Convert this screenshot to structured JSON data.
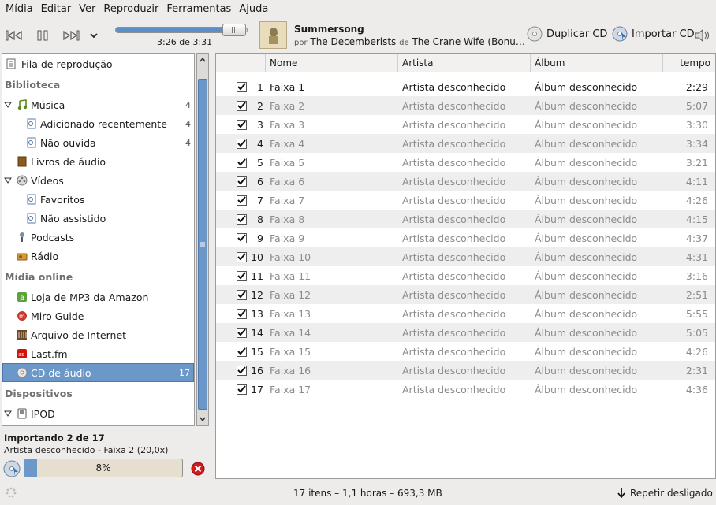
{
  "menu": [
    "Mídia",
    "Editar",
    "Ver",
    "Reproduzir",
    "Ferramentas",
    "Ajuda"
  ],
  "player": {
    "time": "3:26 de 3:31",
    "progress": 0.976,
    "title": "Summersong",
    "by_label": "por",
    "artist": "The Decemberists",
    "of_label": "de",
    "album": "The Crane Wife (Bonu…"
  },
  "actions": {
    "duplicate_cd": "Duplicar CD",
    "import_cd": "Importar CD"
  },
  "sidebar": {
    "queue": "Fila de reprodução",
    "library_header": "Biblioteca",
    "music": "Música",
    "music_count": "4",
    "recent": "Adicionado recentemente",
    "recent_count": "4",
    "unheard": "Não ouvida",
    "unheard_count": "4",
    "audiobooks": "Livros de áudio",
    "videos": "Vídeos",
    "favorites": "Favoritos",
    "unwatched": "Não assistido",
    "podcasts": "Podcasts",
    "radio": "Rádio",
    "online_header": "Mídia online",
    "amazon": "Loja de MP3 da Amazon",
    "miro": "Miro Guide",
    "archive": "Arquivo de Internet",
    "lastfm": "Last.fm",
    "audio_cd": "CD de áudio",
    "audio_cd_count": "17",
    "devices_header": "Dispositivos",
    "ipod": "IPOD"
  },
  "import": {
    "title": "Importando 2 de 17",
    "detail": "Artista desconhecido - Faixa 2 (20,0x)",
    "percent_label": "8%",
    "percent": 0.08
  },
  "table": {
    "headers": {
      "name": "Nome",
      "artist": "Artista",
      "album": "Álbum",
      "time": "tempo"
    },
    "rows": [
      {
        "n": "1",
        "name": "Faixa 1",
        "artist": "Artista desconhecido",
        "album": "Álbum desconhecido",
        "time": "2:29"
      },
      {
        "n": "2",
        "name": "Faixa 2",
        "artist": "Artista desconhecido",
        "album": "Álbum desconhecido",
        "time": "5:07"
      },
      {
        "n": "3",
        "name": "Faixa 3",
        "artist": "Artista desconhecido",
        "album": "Álbum desconhecido",
        "time": "3:30"
      },
      {
        "n": "4",
        "name": "Faixa 4",
        "artist": "Artista desconhecido",
        "album": "Álbum desconhecido",
        "time": "3:34"
      },
      {
        "n": "5",
        "name": "Faixa 5",
        "artist": "Artista desconhecido",
        "album": "Álbum desconhecido",
        "time": "3:21"
      },
      {
        "n": "6",
        "name": "Faixa 6",
        "artist": "Artista desconhecido",
        "album": "Álbum desconhecido",
        "time": "4:11"
      },
      {
        "n": "7",
        "name": "Faixa 7",
        "artist": "Artista desconhecido",
        "album": "Álbum desconhecido",
        "time": "4:26"
      },
      {
        "n": "8",
        "name": "Faixa 8",
        "artist": "Artista desconhecido",
        "album": "Álbum desconhecido",
        "time": "4:15"
      },
      {
        "n": "9",
        "name": "Faixa 9",
        "artist": "Artista desconhecido",
        "album": "Álbum desconhecido",
        "time": "4:37"
      },
      {
        "n": "10",
        "name": "Faixa 10",
        "artist": "Artista desconhecido",
        "album": "Álbum desconhecido",
        "time": "4:31"
      },
      {
        "n": "11",
        "name": "Faixa 11",
        "artist": "Artista desconhecido",
        "album": "Álbum desconhecido",
        "time": "3:16"
      },
      {
        "n": "12",
        "name": "Faixa 12",
        "artist": "Artista desconhecido",
        "album": "Álbum desconhecido",
        "time": "2:51"
      },
      {
        "n": "13",
        "name": "Faixa 13",
        "artist": "Artista desconhecido",
        "album": "Álbum desconhecido",
        "time": "5:55"
      },
      {
        "n": "14",
        "name": "Faixa 14",
        "artist": "Artista desconhecido",
        "album": "Álbum desconhecido",
        "time": "5:05"
      },
      {
        "n": "15",
        "name": "Faixa 15",
        "artist": "Artista desconhecido",
        "album": "Álbum desconhecido",
        "time": "4:26"
      },
      {
        "n": "16",
        "name": "Faixa 16",
        "artist": "Artista desconhecido",
        "album": "Álbum desconhecido",
        "time": "2:31"
      },
      {
        "n": "17",
        "name": "Faixa 17",
        "artist": "Artista desconhecido",
        "album": "Álbum desconhecido",
        "time": "4:36"
      }
    ]
  },
  "status": {
    "summary": "17 itens – 1,1 horas – 693,3 MB",
    "repeat": "Repetir desligado"
  }
}
